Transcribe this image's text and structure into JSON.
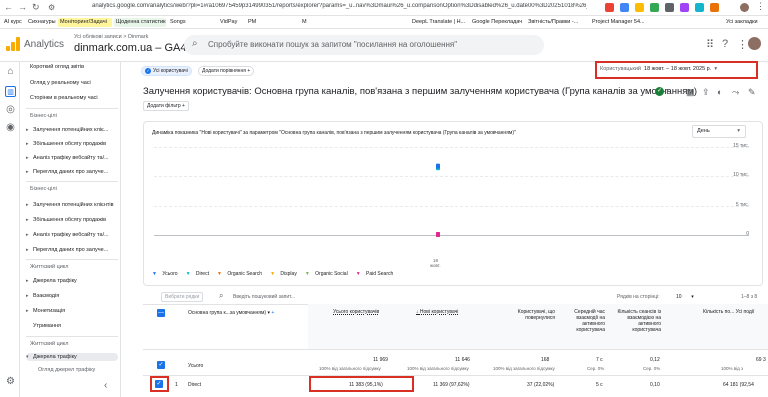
{
  "browser": {
    "url": "analytics.google.com/analytics/web/?pli=1#/a106975459p314990351/reports/explorer?params=_u..nav%3Dmaui%26_u.comparisonOption%3Ddisabled%26_u.date00%3D20251018%26_u.date01%3D2025101...",
    "bookmarks": [
      "AI курс",
      "Сихнагуры",
      "Моніторинг/Задачі",
      "Щоденна статистика",
      "Songs",
      "VidPay",
      "PM",
      "M",
      "DeepL Translate | Н...",
      "Google Перекладач",
      "Звітність/Правки -...",
      "Project Manager 54...",
      "Усі закладки"
    ]
  },
  "header": {
    "product": "Analytics",
    "account_path": "Усі облікові записи > Dinmark",
    "property": "dinmark.com.ua – GA4",
    "search_placeholder": "Спробуйте виконати пошук за запитом \"посилання на оголошення\""
  },
  "sidebar": {
    "top_items": [
      "Короткий огляд звітів",
      "Огляд у реальному часі",
      "Сторінки в реальному часі"
    ],
    "section1_title": "Бізнес-цілі",
    "section1_items": [
      "Залучення потенційних кліє...",
      "Збільшення обсягу продажів",
      "Аналіз трафіку вебсайту та/...",
      "Перегляд даних про залуче..."
    ],
    "section2_title": "Бізнес-цілі",
    "section2_items": [
      "Залучення потенційних клієнтів",
      "Збільшення обсягу продажів",
      "Аналіз трафіку вебсайту та/...",
      "Перегляд даних про залуче..."
    ],
    "section3_title": "Життєвий цикл",
    "section3_items": [
      "Джерела трафіку",
      "Взаємодія",
      "Монетизація",
      "Утримання"
    ],
    "section4_title": "Життєвий цикл",
    "section4_items": [
      "Джерела трафіку",
      "Огляд джерел трафіку"
    ],
    "collapse_icon": "chevron-left-icon"
  },
  "toolbar": {
    "segment_chip": "Усі користувачі",
    "compare_chip": "Додати порівняння",
    "date_label": "Користувацький",
    "date_range": "18 жовт. – 18 жовт. 2025 р.",
    "add_filter": "Додати фільтр"
  },
  "report": {
    "title": "Залучення користувачів: Основна група каналів, пов'язана з першим залученням користувача (Група каналів за умовчанням)"
  },
  "chart": {
    "title": "Динаміка показника \"Нові користувачі\" за параметром \"Основна група каналів, пов'язана з першим залученням користувача (Група каналів за умовчанням)\"",
    "period": "День",
    "y_ticks": [
      "15 тис.",
      "10 тис.",
      "5 тис.",
      "0"
    ],
    "x_label_day": "18",
    "x_label_month": "жовт."
  },
  "chart_data": {
    "type": "scatter",
    "title": "Динаміка показника \"Нові користувачі\" за параметром \"Основна група каналів, пов'язана з першим залученням користувача (Група каналів за умовчанням)\"",
    "x": [
      "18 жовт."
    ],
    "ylim": [
      0,
      15000
    ],
    "y_ticks": [
      0,
      5000,
      10000,
      15000
    ],
    "series": [
      {
        "name": "Усього",
        "values": [
          11646
        ],
        "color": "#1a73e8"
      },
      {
        "name": "Direct",
        "values": [
          11369
        ],
        "color": "#12b5cb"
      },
      {
        "name": "Organic Search",
        "values": [
          0
        ],
        "color": "#e8710a"
      },
      {
        "name": "Display",
        "values": [
          0
        ],
        "color": "#f9ab00"
      },
      {
        "name": "Organic Social",
        "values": [
          0
        ],
        "color": "#7cb342"
      },
      {
        "name": "Paid Search",
        "values": [
          0
        ],
        "color": "#e52592"
      }
    ],
    "grid": true,
    "legend": "bottom"
  },
  "table": {
    "search_chip": "Вибрати рядки",
    "search_placeholder": "Введіть пошуковий запит...",
    "rows_per_page_label": "Рядків на сторінці:",
    "rows_per_page": "10",
    "pagination": "1–8 з 8",
    "dimension_header": "Основна група к...за умовчанням)",
    "columns": [
      {
        "label": "Усього користувачів"
      },
      {
        "label": "Нові користувачі"
      },
      {
        "label": "Користувачі, що повернулися"
      },
      {
        "label": "Середній час взаємодії на активного користувача"
      },
      {
        "label": "Кількість сеансів із взаємодією на активного користувача"
      },
      {
        "label": "Кількість по... Усі події"
      }
    ],
    "total_row": {
      "label": "Усього",
      "values": [
        "11 969",
        "11 646",
        "168",
        "7 с",
        "0,12",
        "69 3"
      ],
      "sub": [
        "100% від загального підсумку",
        "100% від загального підсумку",
        "100% від загального підсумку",
        "Сер. 0%",
        "Сер. 0%",
        "100% від з"
      ]
    },
    "rows": [
      {
        "index": "1",
        "label": "Direct",
        "values": [
          "11 383 (95,1%)",
          "11 369 (97,62%)",
          "37 (22,02%)",
          "5 с",
          "0,10",
          "64 181 (92,54"
        ]
      }
    ]
  }
}
